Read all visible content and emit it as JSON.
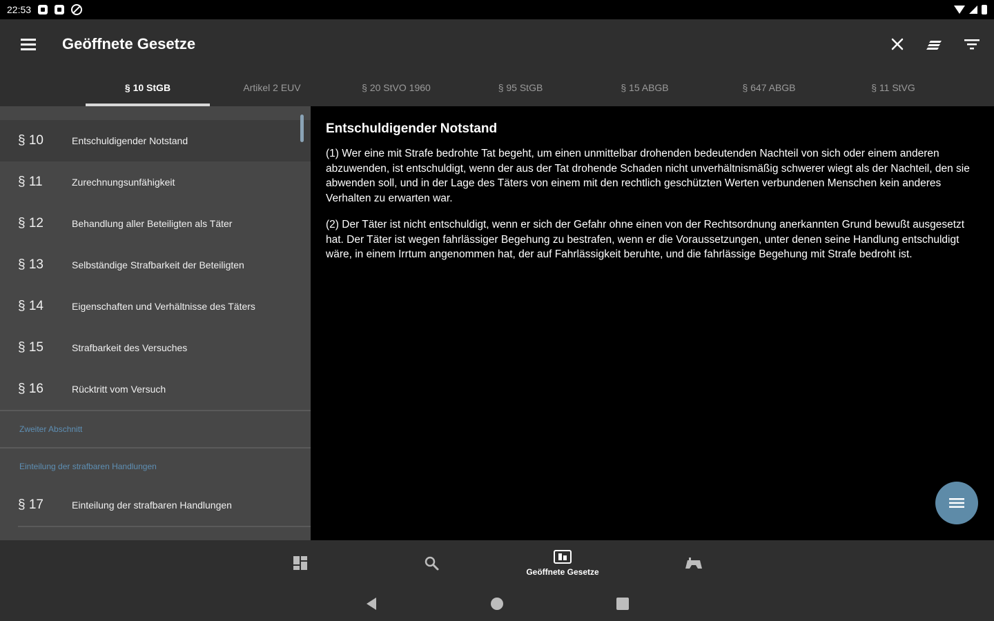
{
  "status_bar": {
    "time": "22:53"
  },
  "app_bar": {
    "title": "Geöffnete Gesetze"
  },
  "tabs": [
    {
      "label": "§ 10 StGB",
      "active": true
    },
    {
      "label": "Artikel 2 EUV",
      "active": false
    },
    {
      "label": "§ 20 StVO 1960",
      "active": false
    },
    {
      "label": "§ 95 StGB",
      "active": false
    },
    {
      "label": "§ 15 ABGB",
      "active": false
    },
    {
      "label": "§ 647 ABGB",
      "active": false
    },
    {
      "label": "§ 11 StVG",
      "active": false
    }
  ],
  "sidebar": {
    "items": [
      {
        "num": "§ 10",
        "label": "Entschuldigender Notstand"
      },
      {
        "num": "§ 11",
        "label": "Zurechnungsunfähigkeit"
      },
      {
        "num": "§ 12",
        "label": "Behandlung aller Beteiligten als Täter"
      },
      {
        "num": "§ 13",
        "label": "Selbständige Strafbarkeit der Beteiligten"
      },
      {
        "num": "§ 14",
        "label": "Eigenschaften und Verhältnisse des Täters"
      },
      {
        "num": "§ 15",
        "label": "Strafbarkeit des Versuches"
      },
      {
        "num": "§ 16",
        "label": "Rücktritt vom Versuch"
      }
    ],
    "section1": "Zweiter Abschnitt",
    "section2": "Einteilung der strafbaren Handlungen",
    "item17": {
      "num": "§ 17",
      "label": "Einteilung der strafbaren Handlungen"
    }
  },
  "content": {
    "title": "Entschuldigender Notstand",
    "p1": "(1) Wer eine mit Strafe bedrohte Tat begeht, um einen unmittelbar drohenden bedeutenden Nachteil von sich oder einem anderen abzuwenden, ist entschuldigt, wenn der aus der Tat drohende Schaden nicht unverhältnismäßig schwerer wiegt als der Nachteil, den sie abwenden soll, und in der Lage des Täters von einem mit den rechtlich geschützten Werten verbundenen Menschen kein anderes Verhalten zu erwarten war.",
    "p2": "(2) Der Täter ist nicht entschuldigt, wenn er sich der Gefahr ohne einen von der Rechtsordnung anerkannten Grund bewußt ausgesetzt hat. Der Täter ist wegen fahrlässiger Begehung zu bestrafen, wenn er die Voraussetzungen, unter denen seine Handlung entschuldigt wäre, in einem Irrtum angenommen hat, der auf Fahrlässigkeit beruhte, und die fahrlässige Begehung mit Strafe bedroht ist."
  },
  "bottom_nav": {
    "active_label": "Geöffnete Gesetze"
  },
  "colors": {
    "accent": "#5e8ba8",
    "section_text": "#5e8fb4",
    "bar_bg": "#2f2f2f",
    "sidebar_bg": "#474747"
  }
}
